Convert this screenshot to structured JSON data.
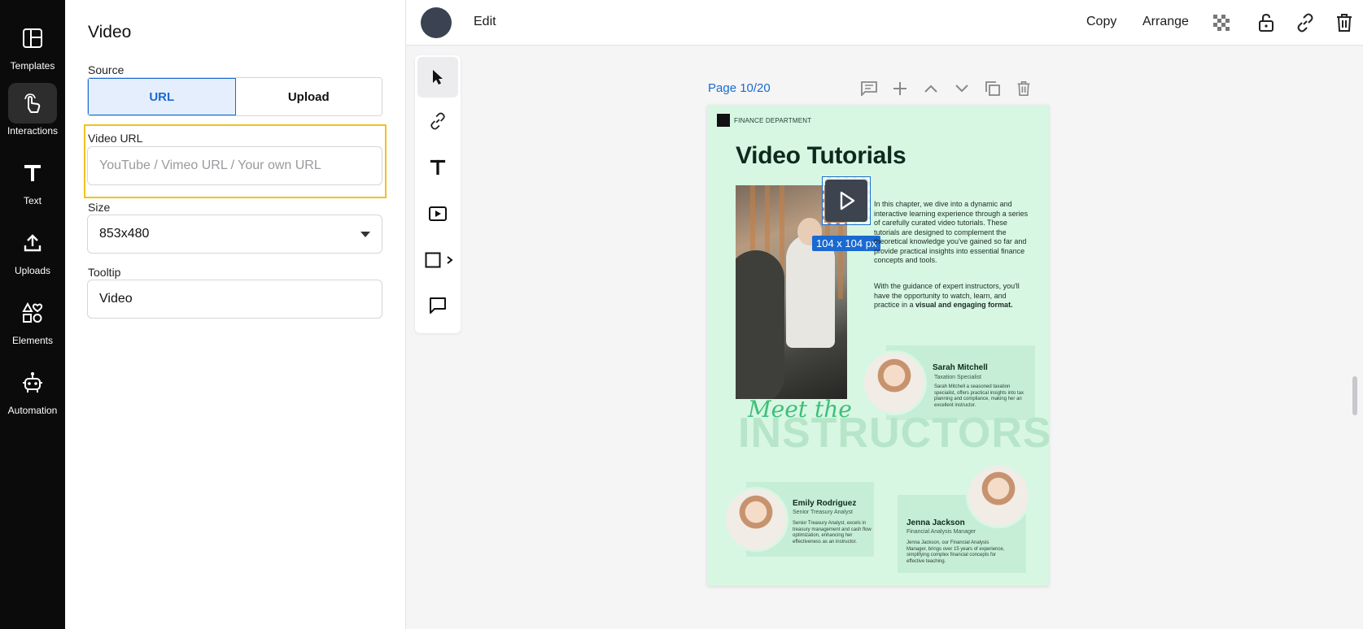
{
  "rail": {
    "items": [
      {
        "label": "Templates",
        "icon": "templates-icon"
      },
      {
        "label": "Interactions",
        "icon": "interactions-icon",
        "active": true
      },
      {
        "label": "Text",
        "icon": "text-icon"
      },
      {
        "label": "Uploads",
        "icon": "uploads-icon"
      },
      {
        "label": "Elements",
        "icon": "elements-icon"
      },
      {
        "label": "Automation",
        "icon": "automation-icon"
      }
    ]
  },
  "panel": {
    "title": "Video",
    "source_label": "Source",
    "source_options": [
      "URL",
      "Upload"
    ],
    "source_selected": "URL",
    "url_label": "Video URL",
    "url_value": "",
    "url_placeholder": "YouTube / Vimeo URL / Your own URL",
    "size_label": "Size",
    "size_value": "853x480",
    "tooltip_label": "Tooltip",
    "tooltip_value": "Video"
  },
  "topbar": {
    "edit_label": "Edit",
    "copy_label": "Copy",
    "arrange_label": "Arrange"
  },
  "page": {
    "label": "Page 10/20",
    "dept": "FINANCE DEPARTMENT",
    "title": "Video Tutorials",
    "size_tag": "104 x 104 px",
    "intro": "In this chapter, we dive into a dynamic and interactive learning experience through a series of carefully curated video tutorials. These tutorials are designed to complement the theoretical knowledge you've gained so far and provide practical insights into essential finance concepts and tools.",
    "intro2": "With the guidance of expert instructors, you'll have the opportunity to watch, learn, and practice in a",
    "intro2_bold": "visual and engaging format.",
    "meet": "Meet the",
    "big": "INSTRUCTORS",
    "instructors": [
      {
        "name": "Sarah Mitchell",
        "role": "Taxation Specialist",
        "desc": "Sarah Mitchell a seasoned taxation specialist, offers practical insights into tax planning and compliance, making her an excellent instructor."
      },
      {
        "name": "Emily Rodriguez",
        "role": "Senior Treasury Analyst",
        "desc": "Senior Treasury Analyst, excels in treasury management and cash flow optimization, enhancing her effectiveness as an instructor."
      },
      {
        "name": "Jenna Jackson",
        "role": "Financial Analysis Manager",
        "desc": "Jenna Jackson, our Financial Analysis Manager, brings over 15 years of experience, simplifying complex financial concepts for effective teaching."
      }
    ]
  },
  "colors": {
    "accent": "#1a6ad1",
    "highlight": "#f1c21b",
    "page_bg": "#d7f7e3"
  }
}
